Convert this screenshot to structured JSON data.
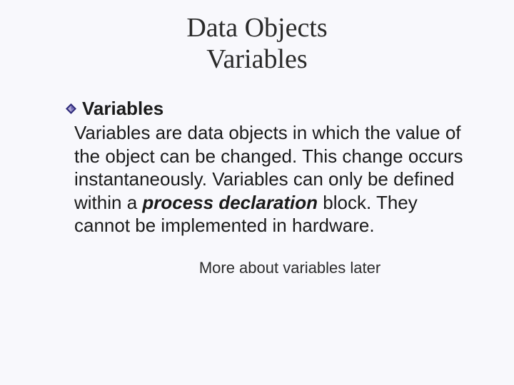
{
  "title": {
    "line1": "Data Objects",
    "line2": "Variables"
  },
  "bullet": {
    "heading": "Variables"
  },
  "body": {
    "part1": " Variables are data objects in which the value of the object can be changed. This change occurs instantaneously. Variables can only be defined within a ",
    "emph": "process declaration",
    "part2": " block. They cannot be implemented in hardware."
  },
  "footnote": "More about variables later"
}
